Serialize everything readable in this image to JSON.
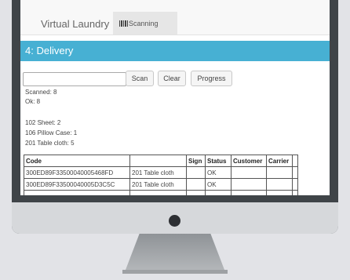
{
  "app": {
    "brand": "Virtual Laundry",
    "nav_tab": "Scanning"
  },
  "page": {
    "header": "4: Delivery"
  },
  "search": {
    "value": "",
    "placeholder": ""
  },
  "buttons": {
    "scan": "Scan",
    "clear": "Clear",
    "progress": "Progress"
  },
  "summary": {
    "scanned": "Scanned: 8",
    "ok": "Ok: 8"
  },
  "items": [
    "102 Sheet: 2",
    "106 Pillow Case: 1",
    "201 Table cloth: 5"
  ],
  "table": {
    "columns": [
      "Code",
      "",
      "Sign",
      "Status",
      "Customer",
      "Carrier"
    ],
    "rows": [
      [
        "300ED89F33500040005468FD",
        "201 Table cloth",
        "",
        "OK",
        "",
        ""
      ],
      [
        "300ED89F33500040005D3C5C",
        "201 Table cloth",
        "",
        "OK",
        "",
        ""
      ],
      [
        "",
        "",
        "",
        "",
        "",
        ""
      ]
    ]
  },
  "colors": {
    "header_bar": "#47b0d3",
    "monitor_bezel": "#3f4448",
    "monitor_chin": "#d6d8db"
  },
  "icons": {
    "nav_tab": "barcode-icon",
    "power": "power-indicator"
  }
}
